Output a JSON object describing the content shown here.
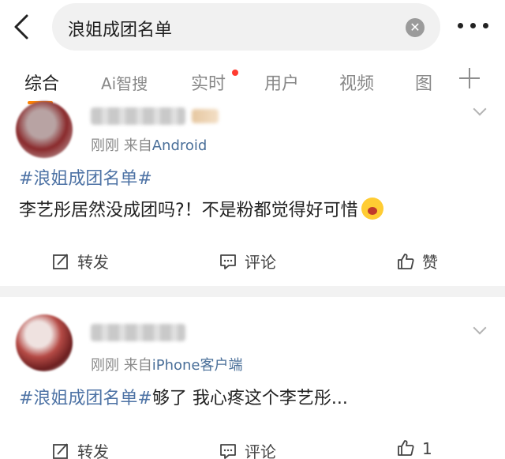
{
  "search": {
    "query": "浪姐成团名单",
    "clear_icon": "close-circle-icon"
  },
  "tabs": [
    {
      "label": "综合",
      "active": true
    },
    {
      "label": "Ai智搜"
    },
    {
      "label": "实时",
      "has_red_dot": true
    },
    {
      "label": "用户"
    },
    {
      "label": "视频"
    },
    {
      "label": "图"
    }
  ],
  "posts": [
    {
      "time": "刚刚",
      "from_prefix": "来自",
      "source": "Android",
      "hashtag": "#浪姐成团名单#",
      "text": "李艺彤居然没成团吗?！不是粉都觉得好可惜",
      "emoji": "crying-face-icon",
      "actions": {
        "repost": "转发",
        "comment": "评论",
        "like": "赞"
      }
    },
    {
      "time": "刚刚",
      "from_prefix": "来自",
      "source": "iPhone客户端",
      "hashtag": "#浪姐成团名单#",
      "text": "够了 我心疼这个李艺彤...",
      "actions": {
        "repost": "转发",
        "comment": "评论",
        "like": "1"
      }
    }
  ]
}
